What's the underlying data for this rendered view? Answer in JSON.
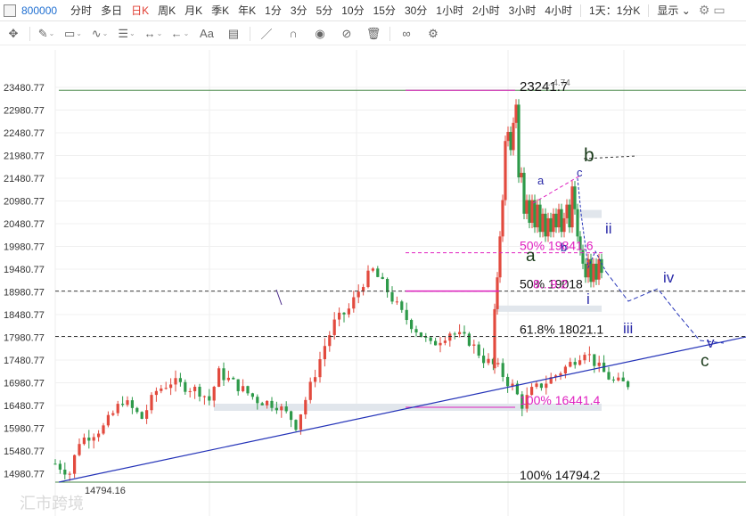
{
  "topbar": {
    "code": "800000",
    "periods": [
      "分时",
      "多日",
      "日K",
      "周K",
      "月K",
      "季K",
      "年K",
      "1分",
      "3分",
      "5分",
      "10分",
      "15分",
      "30分",
      "1小时",
      "2小时",
      "3小时",
      "4小时"
    ],
    "active_period": "日K",
    "display_mode": "1天：1分K",
    "show_label": "显示"
  },
  "toolbar": {
    "tools": [
      "move-icon",
      "pen-icon",
      "rect-icon",
      "wave-icon",
      "list-icon",
      "range-icon",
      "arrow-icon",
      "text-icon",
      "note-icon",
      "line-icon",
      "magnet-icon",
      "eye-icon",
      "hide-icon",
      "trash-icon",
      "link-icon",
      "settings-icon"
    ],
    "text_tool_label": "Aa"
  },
  "chart_data": {
    "type": "candlestick",
    "y_ticks": [
      "23480.77",
      "22980.77",
      "22480.77",
      "21980.77",
      "21480.77",
      "20980.77",
      "20480.77",
      "19980.77",
      "19480.77",
      "18980.77",
      "18480.77",
      "17980.77",
      "17480.77",
      "16980.77",
      "16480.77",
      "15980.77",
      "15480.77",
      "14980.77"
    ],
    "ylim": [
      14650,
      23700
    ],
    "n_candles": 120,
    "low_label": "14794.16",
    "high_label": "23241.7",
    "high_label_ghost": "...4.74",
    "levels": [
      {
        "label": "100% 14794.2",
        "value": 14794.2,
        "color": "#4a8a4a",
        "style": "solid",
        "text_color": "#111111"
      },
      {
        "label": "23241.7",
        "value": 23418,
        "color": "#4a8a4a",
        "style": "solid",
        "text_color": "#111111"
      },
      {
        "label": "61.8% 18021.1",
        "value": 18000,
        "color": "#333333",
        "style": "dashed",
        "text_color": "#111111"
      },
      {
        "label": "50% 19018",
        "value": 18998,
        "color": "#444444",
        "style": "dashed",
        "text_color": "#111111"
      },
      {
        "label": "50% 19841.6",
        "value": 19841.6,
        "color": "#e020c0",
        "style": "dashed",
        "text_color": "#e020c0"
      },
      {
        "label": "100% 16441.4",
        "value": 16441.4,
        "color": "#e020c0",
        "style": "solid",
        "text_color": "#e020c0"
      }
    ],
    "overlap_label": "8...9.2",
    "wave_labels": [
      {
        "text": "a",
        "color": "#1a3a1a",
        "size": 19
      },
      {
        "text": "b",
        "color": "#1a3a1a",
        "size": 21
      },
      {
        "text": "c",
        "color": "#1a3a1a",
        "size": 19
      },
      {
        "text": "a",
        "color": "#2a2aa8",
        "size": 13
      },
      {
        "text": "b",
        "color": "#2a2aa8",
        "size": 13
      },
      {
        "text": "c",
        "color": "#2a2aa8",
        "size": 13
      },
      {
        "text": "i",
        "color": "#2a2aa8",
        "size": 17
      },
      {
        "text": "ii",
        "color": "#2a2aa8",
        "size": 17
      },
      {
        "text": "iii",
        "color": "#2a2aa8",
        "size": 17
      },
      {
        "text": "iv",
        "color": "#2a2aa8",
        "size": 17
      },
      {
        "text": "v",
        "color": "#2a2aa8",
        "size": 17
      }
    ],
    "colors": {
      "up": "#e24a3e",
      "down": "#2e9a4a",
      "trend": "#2433b8",
      "fib_pink": "#e020c0",
      "green_line": "#4a8a4a"
    },
    "watermark": "汇市跨境"
  }
}
